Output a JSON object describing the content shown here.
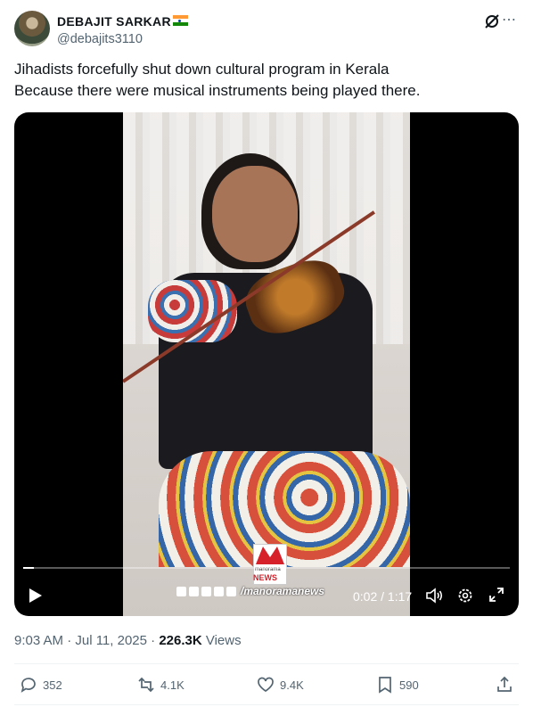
{
  "user": {
    "display_name": "DEBAJIT SARKAR",
    "handle": "@debajits3110",
    "flag_colors": [
      "#ff9933",
      "#ffffff",
      "#138808"
    ]
  },
  "tweet": {
    "line1": "Jihadists forcefully shut down cultural program in Kerala",
    "line2": "Because there were musical instruments being played there."
  },
  "video": {
    "watermark": "manorama",
    "watermark_news": "NEWS",
    "social_handle": "/manoramanews",
    "time": "0:02 / 1:17",
    "progress_fraction": 0.004
  },
  "meta": {
    "time_date": "9:03 AM · Jul 11, 2025 · ",
    "views_count": "226.3K",
    "views_label": " Views"
  },
  "actions": {
    "reply": "352",
    "repost": "4.1K",
    "like": "9.4K",
    "bookmark": "590"
  },
  "colors": {
    "text_secondary": "#536471",
    "text_primary": "#0f1419",
    "divider": "#eff3f4"
  }
}
